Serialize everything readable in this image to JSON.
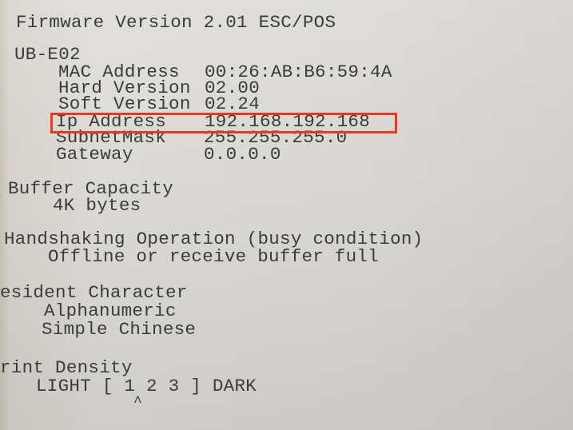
{
  "firmware": "Firmware Version 2.01 ESC/POS",
  "device": {
    "model": "UB-E02",
    "rows": [
      {
        "label": "MAC Address",
        "value": "00:26:AB:B6:59:4A"
      },
      {
        "label": "Hard Version",
        "value": "02.00"
      },
      {
        "label": "Soft Version",
        "value": "02.24"
      },
      {
        "label": "Ip Address",
        "value": "192.168.192.168"
      },
      {
        "label": "SubnetMask",
        "value": "255.255.255.0"
      },
      {
        "label": "Gateway",
        "value": "0.0.0.0"
      }
    ],
    "highlight_color": "#f0351f"
  },
  "buffer": {
    "title": "Buffer Capacity",
    "value": "4K bytes"
  },
  "handshaking": {
    "title": "Handshaking Operation (busy condition)",
    "value": "Offline or receive buffer full"
  },
  "resident": {
    "title": "esident Character",
    "values": [
      "Alphanumeric",
      "Simple Chinese"
    ]
  },
  "density": {
    "title": "rint Density",
    "scale": "LIGHT [ 1 2 3 ] DARK",
    "selected": 1,
    "marker": "^"
  }
}
